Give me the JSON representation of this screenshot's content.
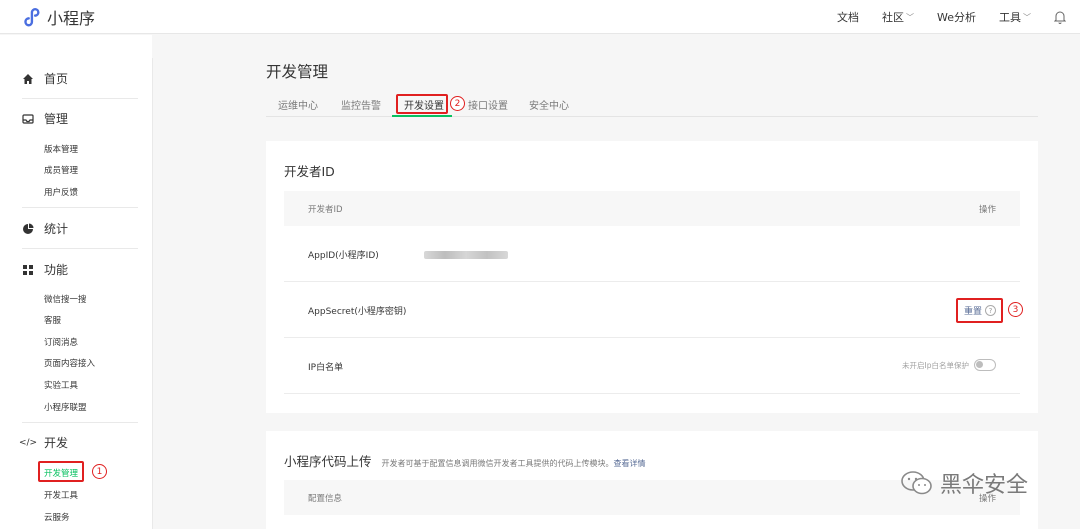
{
  "brand": {
    "name": "小程序"
  },
  "topnav": {
    "docs": "文档",
    "community": "社区",
    "we_analysis": "We分析",
    "tools": "工具"
  },
  "sidebar": {
    "home": "首页",
    "manage": {
      "label": "管理",
      "items": [
        "版本管理",
        "成员管理",
        "用户反馈"
      ]
    },
    "stats": "统计",
    "features": {
      "label": "功能",
      "items": [
        "微信搜一搜",
        "客服",
        "订阅消息",
        "页面内容接入",
        "实验工具",
        "小程序联盟"
      ]
    },
    "dev": {
      "label": "开发",
      "items": [
        "开发管理",
        "开发工具",
        "云服务"
      ]
    }
  },
  "page": {
    "title": "开发管理"
  },
  "tabs": [
    "运维中心",
    "监控告警",
    "开发设置",
    "接口设置",
    "安全中心"
  ],
  "developer_id": {
    "title": "开发者ID",
    "col_left": "开发者ID",
    "col_right": "操作",
    "rows": [
      {
        "label": "AppID(小程序ID)"
      },
      {
        "label": "AppSecret(小程序密钥)",
        "action": "重置"
      },
      {
        "label": "IP白名单",
        "note": "未开启Ip白名单保护"
      }
    ]
  },
  "upload": {
    "title": "小程序代码上传",
    "desc": "开发者可基于配置信息调用微信开发者工具提供的代码上传模块。",
    "link": "查看详情",
    "col_left": "配置信息",
    "col_right": "操作"
  },
  "annotations": [
    "1",
    "2",
    "3"
  ],
  "watermark": "黑伞安全",
  "colors": {
    "accent": "#07c160",
    "link": "#576b95",
    "annotation": "#e02020"
  }
}
